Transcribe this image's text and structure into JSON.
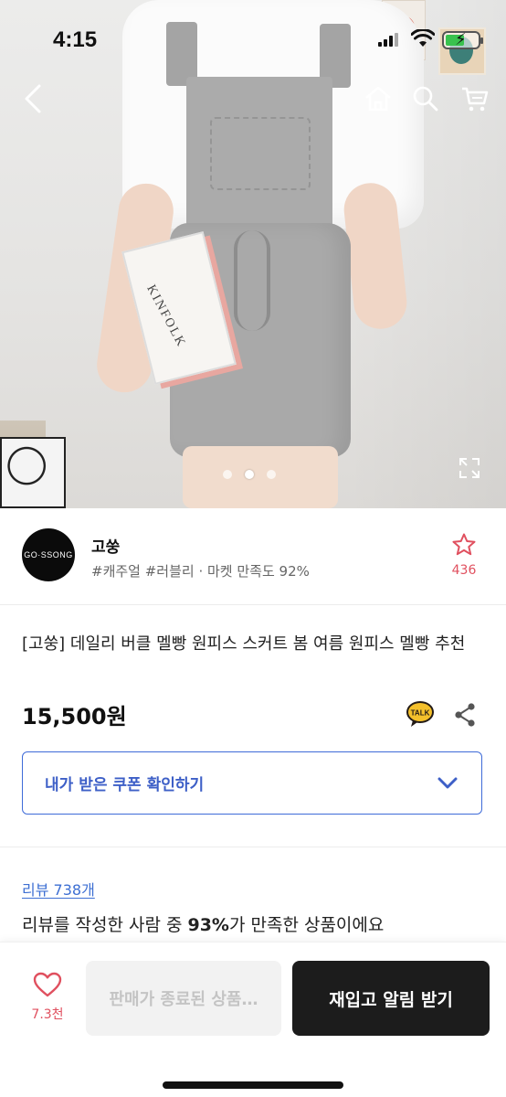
{
  "status_bar": {
    "time": "4:15"
  },
  "hero": {
    "book_text": "KINFOLK",
    "page_dots": 3,
    "active_dot": 1
  },
  "seller": {
    "logo_text": "GO·SSONG",
    "name": "고쑹",
    "tags": "#캐주얼 #러블리 · 마켓 만족도 92%",
    "favorite_count": "436"
  },
  "product": {
    "title": "[고쑹] 데일리 버클 멜빵 원피스 스커트 봄 여름 원피스 멜빵 추천",
    "price": "15,500원",
    "talk_label": "TALK"
  },
  "coupon": {
    "label": "내가 받은 쿠폰 확인하기"
  },
  "review": {
    "link": "리뷰 738개",
    "summary_prefix": "리뷰를 작성한 사람 중 ",
    "summary_pct": "93%",
    "summary_suffix": "가 만족한 상품이에요"
  },
  "bottom_bar": {
    "like_count": "7.3천",
    "ended_label": "판매가 종료된 상품…",
    "restock_label": "재입고 알림 받기"
  },
  "colors": {
    "accent_blue": "#3d5fc7",
    "accent_red": "#e0505f",
    "dark": "#1c1c1c"
  }
}
